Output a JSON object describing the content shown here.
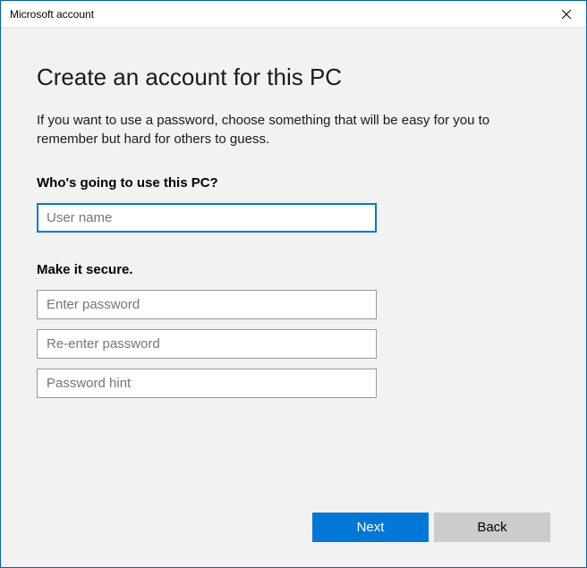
{
  "window": {
    "title": "Microsoft account"
  },
  "main": {
    "heading": "Create an account for this PC",
    "description": "If you want to use a password, choose something that will be easy for you to remember but hard for others to guess.",
    "section_user_label": "Who's going to use this PC?",
    "section_secure_label": "Make it secure.",
    "username_placeholder": "User name",
    "password_placeholder": "Enter password",
    "repassword_placeholder": "Re-enter password",
    "hint_placeholder": "Password hint"
  },
  "footer": {
    "next_label": "Next",
    "back_label": "Back"
  }
}
